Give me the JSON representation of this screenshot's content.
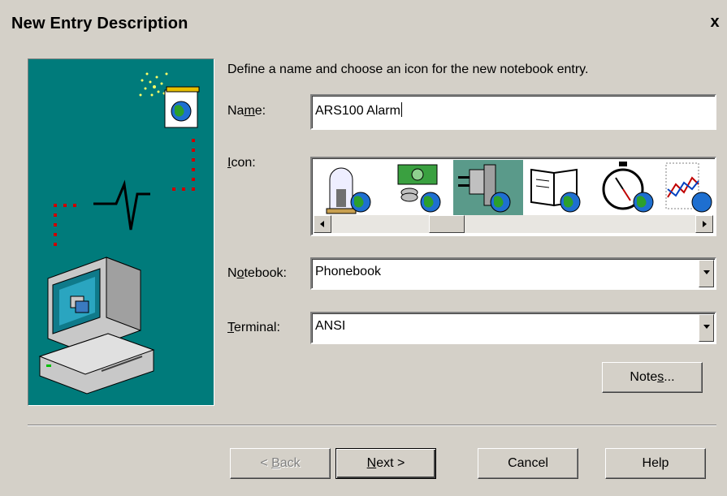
{
  "dialog": {
    "title": "New Entry Description",
    "close_symbol": "x",
    "intro": "Define a name and choose an icon for the new notebook entry."
  },
  "form": {
    "name": {
      "label_pre": "Na",
      "label_key": "m",
      "label_post": "e:",
      "value": "ARS100 Alarm"
    },
    "icon": {
      "label_pre": "",
      "label_key": "I",
      "label_post": "con:",
      "items": [
        {
          "name": "bell-jar-globe-icon"
        },
        {
          "name": "money-coins-globe-icon"
        },
        {
          "name": "power-plug-globe-icon",
          "selected": true
        },
        {
          "name": "open-book-globe-icon"
        },
        {
          "name": "stopwatch-globe-icon"
        },
        {
          "name": "line-chart-globe-icon"
        }
      ]
    },
    "notebook": {
      "label_pre": "N",
      "label_key": "o",
      "label_post": "tebook:",
      "value": "Phonebook"
    },
    "terminal": {
      "label_pre": "",
      "label_key": "T",
      "label_post": "erminal:",
      "value": "ANSI"
    },
    "notes_button": {
      "pre": "Note",
      "key": "s",
      "post": "..."
    }
  },
  "buttons": {
    "back": {
      "pre": "< ",
      "key": "B",
      "post": "ack"
    },
    "next": {
      "pre": "",
      "key": "N",
      "post": "ext >"
    },
    "cancel": "Cancel",
    "help": "Help"
  },
  "colors": {
    "dialog_bg": "#d4d0c8",
    "illustration_bg": "#007b7b",
    "selected_icon_bg": "#5a9a8a"
  }
}
